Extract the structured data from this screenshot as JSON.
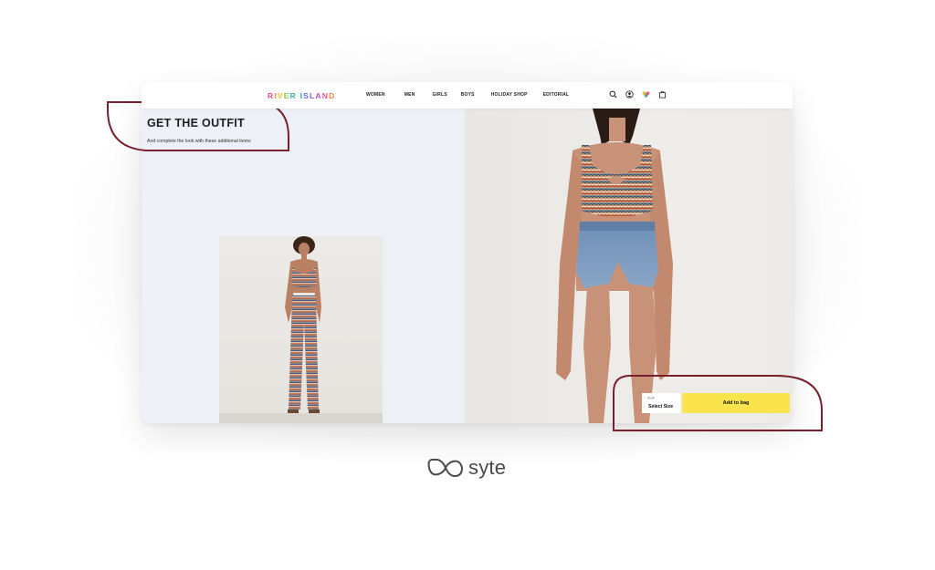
{
  "header": {
    "logo_letters": [
      {
        "ch": "R",
        "color": "#e84b8a"
      },
      {
        "ch": "I",
        "color": "#f28c28"
      },
      {
        "ch": "V",
        "color": "#f2c12e"
      },
      {
        "ch": "E",
        "color": "#8cc63f"
      },
      {
        "ch": "R",
        "color": "#3ab5a5"
      },
      {
        "ch": " ",
        "color": "#ffffff"
      },
      {
        "ch": "I",
        "color": "#2e9bd6"
      },
      {
        "ch": "S",
        "color": "#5b6fd6"
      },
      {
        "ch": "L",
        "color": "#8a5fd0"
      },
      {
        "ch": "A",
        "color": "#c04fb8"
      },
      {
        "ch": "N",
        "color": "#e8568c"
      },
      {
        "ch": "D",
        "color": "#f0803c"
      }
    ],
    "nav": [
      "WOMEN",
      "MEN",
      "GIRLS",
      "BOYS",
      "HOLIDAY SHOP",
      "EDITORIAL"
    ],
    "icons": [
      "search-icon",
      "account-icon",
      "heart-icon",
      "bag-icon"
    ]
  },
  "outfit": {
    "title": "GET THE OUTFIT",
    "subtitle": "And complete the look with these additional items"
  },
  "cta": {
    "size_arrow": "<-->",
    "size_label": "Select Size",
    "add_to_bag": "Add to bag"
  },
  "brand": {
    "name": "syte"
  },
  "colors": {
    "highlight": "#7a1f2e",
    "add_to_bag": "#f9e44e",
    "left_panel": "#edf0f7"
  }
}
